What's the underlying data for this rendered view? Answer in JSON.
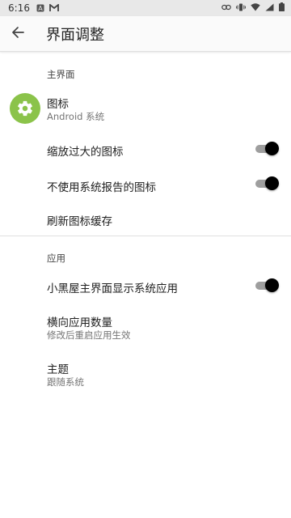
{
  "status_bar": {
    "time": "6:16"
  },
  "app_bar": {
    "title": "界面调整"
  },
  "sections": {
    "home": {
      "title": "主界面",
      "icon_setting": {
        "label": "图标",
        "summary": "Android 系统"
      },
      "scale_icons": {
        "label": "缩放过大的图标",
        "checked": true
      },
      "no_system_report_icons": {
        "label": "不使用系统报告的图标",
        "checked": true
      },
      "refresh_icon_cache": {
        "label": "刷新图标缓存"
      }
    },
    "apps": {
      "title": "应用",
      "show_system_apps": {
        "label": "小黑屋主界面显示系统应用",
        "checked": true
      },
      "horizontal_app_count": {
        "label": "横向应用数量",
        "summary": "修改后重启应用生效"
      },
      "theme": {
        "label": "主题",
        "summary": "跟随系统"
      }
    }
  },
  "colors": {
    "accent": "#8bc34a",
    "switch_thumb": "#000000",
    "switch_track": "#9e9e9e",
    "statusbar": "#e8e8e8"
  }
}
